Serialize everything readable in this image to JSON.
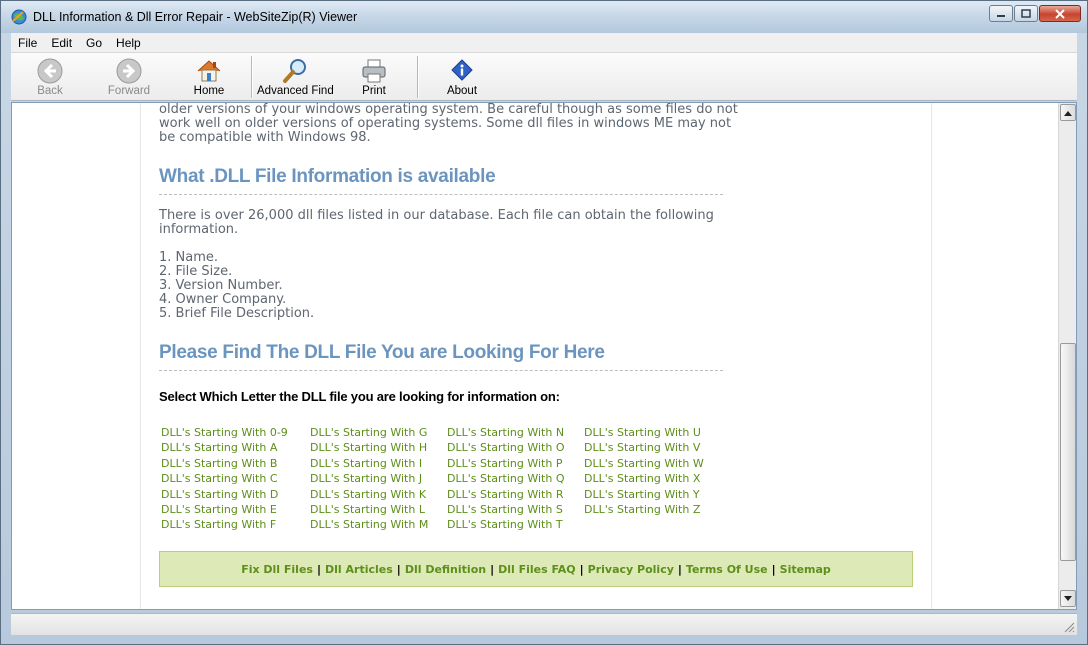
{
  "window": {
    "title": "DLL Information & Dll Error Repair - WebSiteZip(R) Viewer"
  },
  "menu": [
    "File",
    "Edit",
    "Go",
    "Help"
  ],
  "toolbar": {
    "back": "Back",
    "forward": "Forward",
    "home": "Home",
    "advanced_find": "Advanced Find",
    "print": "Print",
    "about": "About"
  },
  "content": {
    "intro_lines": [
      "older versions of your windows operating system. Be careful though as some files do not",
      "work well on older versions of operating systems. Some dll files in windows ME may not",
      "be compatible with Windows 98."
    ],
    "section1_title": "What .DLL File Information is available",
    "section1_lines": [
      "There is over 26,000 dll files listed in our database. Each file can obtain the following",
      "information."
    ],
    "info_list": [
      "1. Name.",
      "2. File Size.",
      "3. Version Number.",
      "4. Owner Company.",
      "5. Brief File Description."
    ],
    "section2_title": "Please Find The DLL File You are Looking For Here",
    "select_heading": "Select Which Letter the DLL file you are looking for information on:",
    "letter_columns": [
      [
        "DLL's Starting With 0-9",
        "DLL's Starting With A",
        "DLL's Starting With B",
        "DLL's Starting With C",
        "DLL's Starting With D",
        "DLL's Starting With E",
        "DLL's Starting With F"
      ],
      [
        "DLL's Starting With G",
        "DLL's Starting With H",
        "DLL's Starting With I",
        "DLL's Starting With J",
        "DLL's Starting With K",
        "DLL's Starting With L",
        "DLL's Starting With M"
      ],
      [
        "DLL's Starting With N",
        "DLL's Starting With O",
        "DLL's Starting With P",
        "DLL's Starting With Q",
        "DLL's Starting With R",
        "DLL's Starting With S",
        "DLL's Starting With T"
      ],
      [
        "DLL's Starting With U",
        "DLL's Starting With V",
        "DLL's Starting With W",
        "DLL's Starting With X",
        "DLL's Starting With Y",
        "DLL's Starting With Z"
      ]
    ],
    "footer_links": [
      "Fix Dll Files",
      "Dll Articles",
      "Dll Definition",
      "Dll Files FAQ",
      "Privacy Policy",
      "Terms Of Use",
      "Sitemap"
    ],
    "footer_separator": "|"
  },
  "colors": {
    "heading": "#6b95bf",
    "link": "#5d8f1a",
    "footer_bg": "#dde9b6"
  },
  "icons": {
    "back": "back-arrow-icon",
    "forward": "forward-arrow-icon",
    "home": "home-icon",
    "advanced_find": "magnifier-icon",
    "print": "printer-icon",
    "about": "info-icon"
  }
}
